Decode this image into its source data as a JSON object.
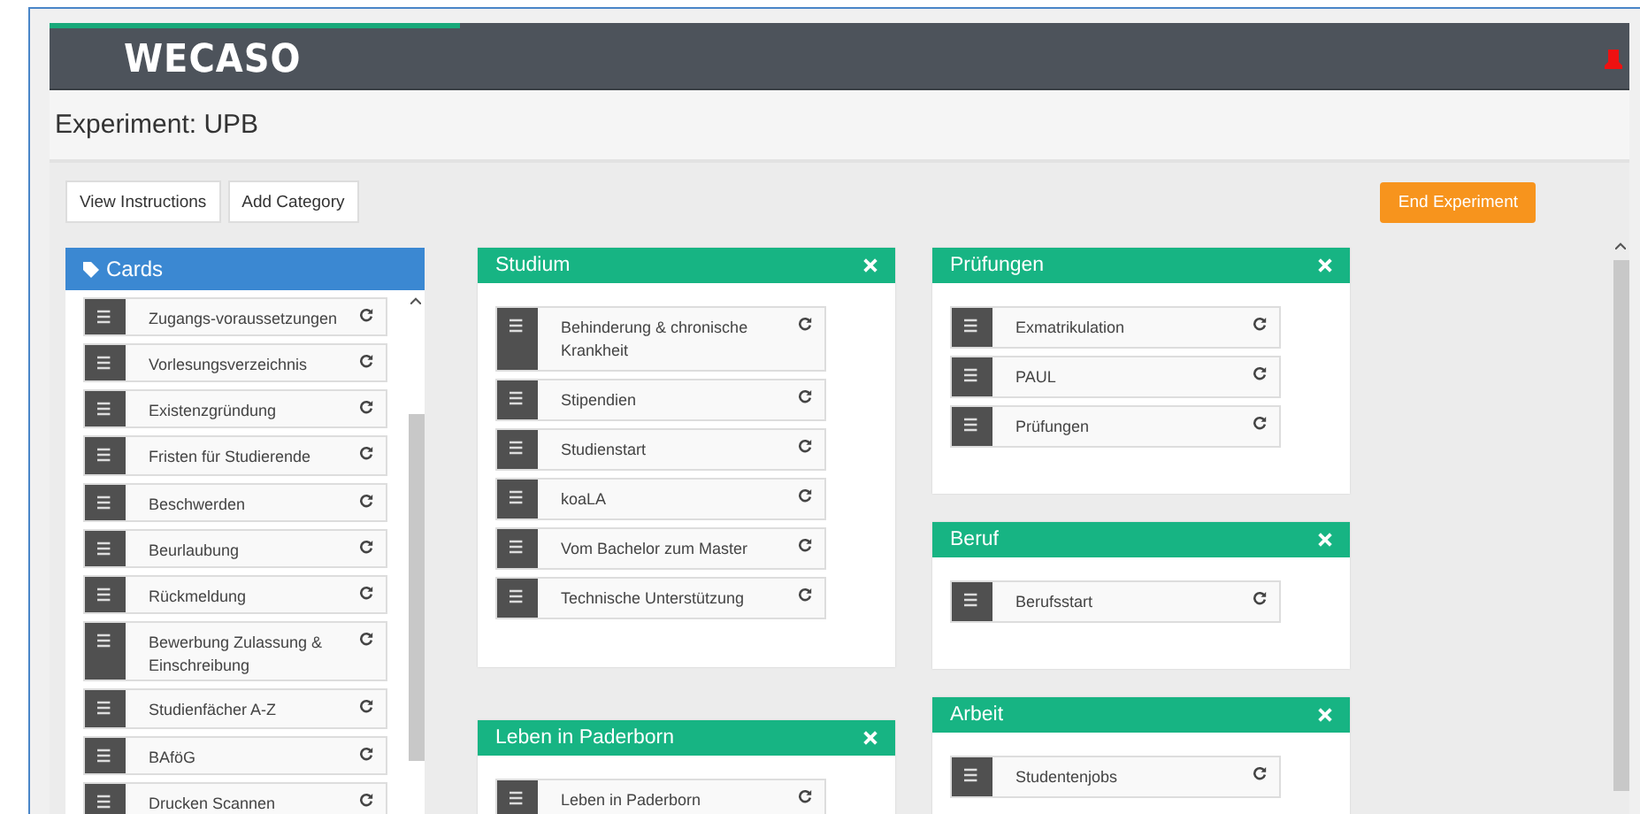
{
  "header": {
    "logo": "WECASO",
    "progress": {
      "level": 0.26
    }
  },
  "title": "Experiment: UPB",
  "toolbar": {
    "buttons": [
      "View Instructions",
      "Add Category"
    ],
    "end_button": "End Experiment"
  },
  "cards_panel": {
    "title": "Cards",
    "cards": [
      {
        "label": "Zugangs-voraussetzungen"
      },
      {
        "label": "Vorlesungsverzeichnis"
      },
      {
        "label": "Existenzgründung"
      },
      {
        "label": "Fristen für Studierende"
      },
      {
        "label": "Beschwerden"
      },
      {
        "label": "Beurlaubung"
      },
      {
        "label": "Rückmeldung"
      },
      {
        "label": "Bewerbung Zulassung & Einschreibung"
      },
      {
        "label": "Studienfächer A-Z"
      },
      {
        "label": "BAföG"
      },
      {
        "label": "Drucken Scannen"
      }
    ]
  },
  "categories": [
    [
      {
        "title": "Studium",
        "cards": [
          "Behinderung & chronische Krankheit",
          "Stipendien",
          "Studienstart",
          "koaLA",
          "Vom Bachelor zum Master",
          "Technische Unterstützung"
        ]
      },
      {
        "title": "Leben in Paderborn",
        "cards": [
          "Leben in Paderborn"
        ]
      }
    ],
    [
      {
        "title": "Prüfungen",
        "cards": [
          "Exmatrikulation",
          "PAUL",
          "Prüfungen"
        ]
      },
      {
        "title": "Beruf",
        "cards": [
          "Berufsstart"
        ]
      },
      {
        "title": "Arbeit",
        "cards": [
          "Studentenjobs"
        ]
      }
    ]
  ]
}
